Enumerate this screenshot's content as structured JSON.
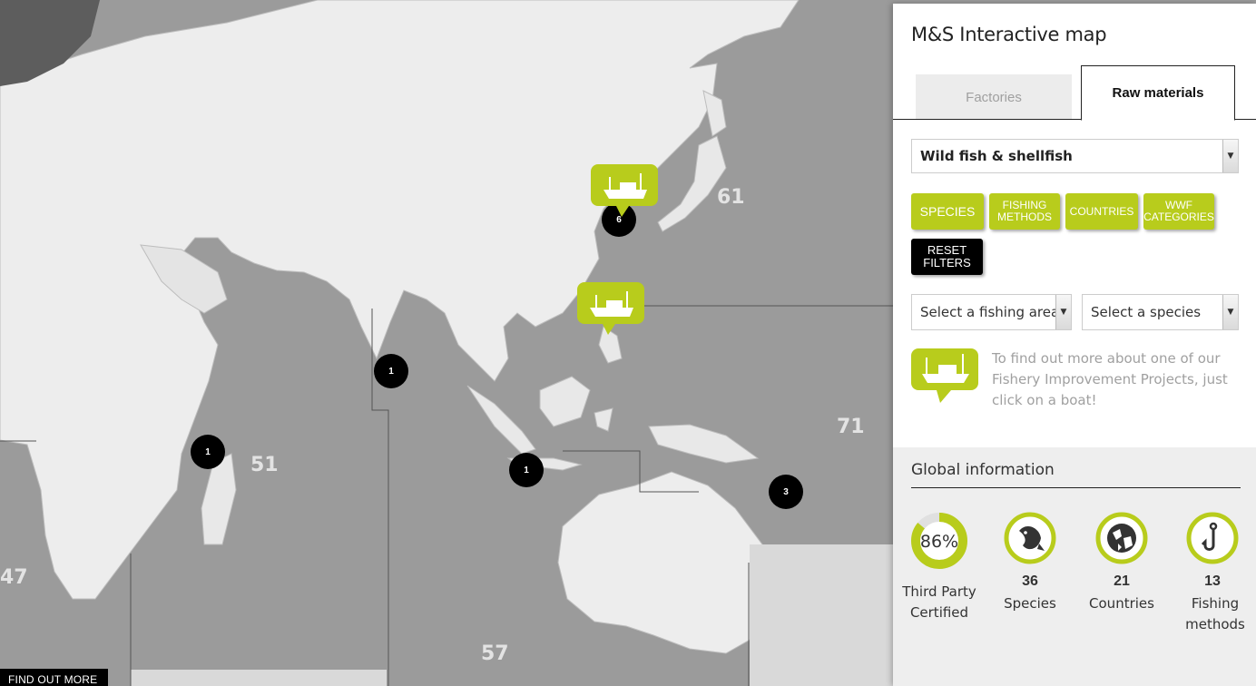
{
  "panel": {
    "title": "M&S Interactive map",
    "tabs": {
      "factories": "Factories",
      "raw_materials": "Raw materials"
    },
    "category_select": "Wild fish & shellfish",
    "filters": [
      "SPECIES",
      "FISHING METHODS",
      "COUNTRIES",
      "WWF CATEGORIES"
    ],
    "reset": "RESET FILTERS",
    "area_select": "Select a fishing area",
    "species_select": "Select a species",
    "info": "To find out more about one of our Fishery Improvement Projects, just click on a boat!",
    "accent": "#b8cc1c"
  },
  "global": {
    "title": "Global information",
    "certified": {
      "value": "86%",
      "fraction": 0.86,
      "label": "Third Party Certified"
    },
    "species": {
      "value": "36",
      "label": "Species"
    },
    "countries": {
      "value": "21",
      "label": "Countries"
    },
    "methods": {
      "value": "13",
      "label": "Fishing methods"
    }
  },
  "map": {
    "area_labels": [
      "61",
      "71",
      "51",
      "57",
      "47"
    ],
    "clusters": [
      "6",
      "1",
      "1",
      "1",
      "3"
    ],
    "find_more": "FIND OUT MORE"
  }
}
